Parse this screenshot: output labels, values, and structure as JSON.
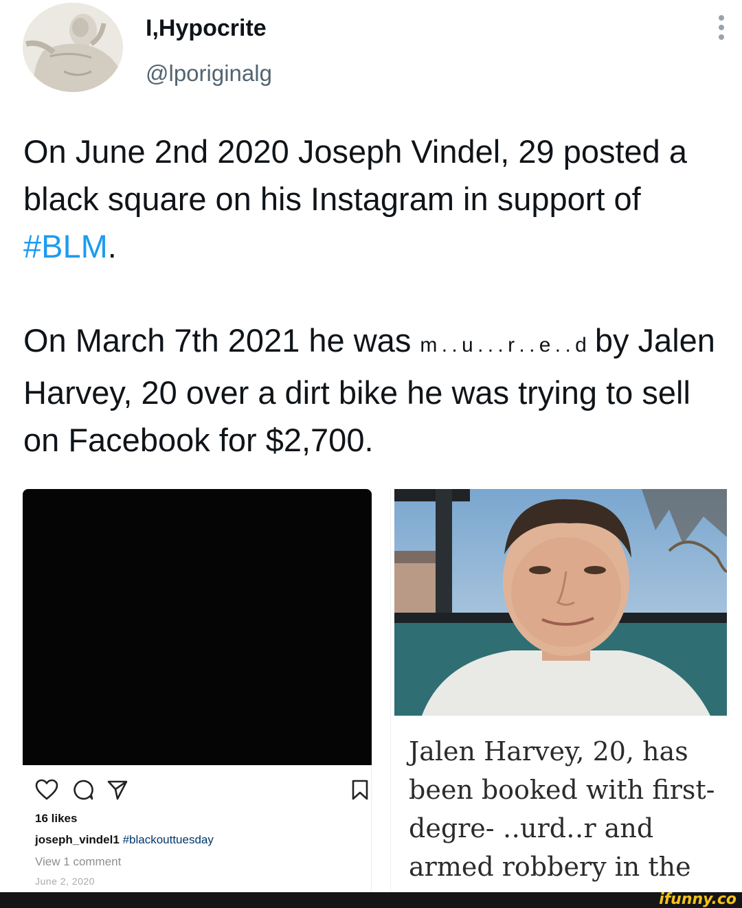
{
  "tweet": {
    "display_name": "I,Hypocrite",
    "handle": "@lporiginalg",
    "avatar_icon": "marble-statue-avatar",
    "more_icon": "vertical-ellipsis-icon",
    "paragraph1_before": "On June 2nd 2020 Joseph Vindel, 29 posted a black square on his Instagram in support of ",
    "hashtag": "#BLM",
    "paragraph1_after": ".",
    "paragraph2_before": "On March 7th 2021 he was ",
    "redacted_word": "m . . u . . . r . . e . . d",
    "paragraph2_after": " by Jalen Harvey, 20 over a dirt bike he was trying to sell on Facebook for $2,700.",
    "hashtag_color": "#1d9bf0"
  },
  "instagram_post": {
    "image": "black-square",
    "likes": "16 likes",
    "username": "joseph_vindel1",
    "caption_tag": "#blackouttuesday",
    "view_comments": "View 1 comment",
    "date": "June 2, 2020",
    "icons": [
      "heart-icon",
      "comment-icon",
      "share-icon",
      "bookmark-icon"
    ]
  },
  "news_article": {
    "photo": "man-selfie-outdoors",
    "caption_line1": "Jalen Harvey, 20, has",
    "caption_line2": "been booked with first-",
    "caption_line3": "degre‐ ․․urd․․r and",
    "caption_line4": "armed robbery in the"
  },
  "watermark": {
    "text": "ifunny.co",
    "color": "#f6c21a"
  }
}
